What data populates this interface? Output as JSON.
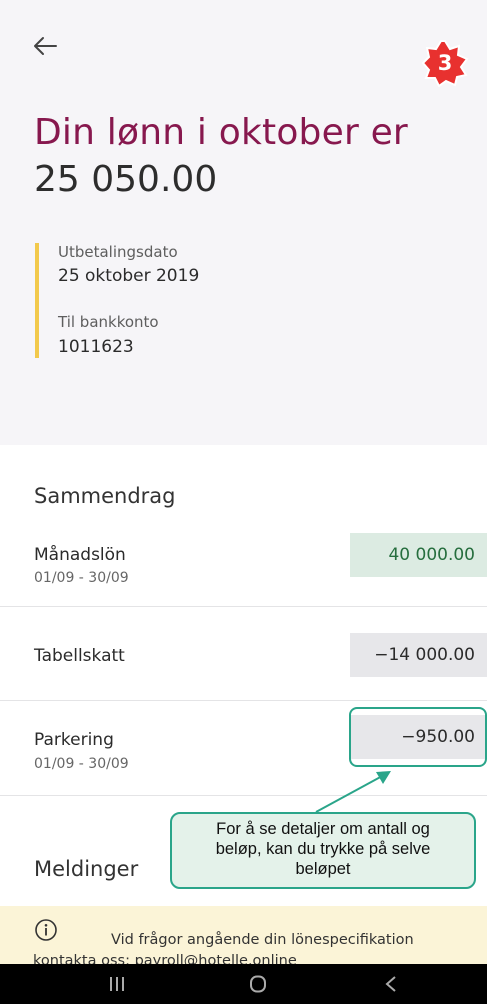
{
  "step_badge": "3",
  "header": {
    "title_line1": "Din lønn i oktober er",
    "title_line2": "25 050.00"
  },
  "payment_info": {
    "date_label": "Utbetalingsdato",
    "date_value": "25 oktober 2019",
    "account_label": "Til bankkonto",
    "account_value": "1011623"
  },
  "summary": {
    "title": "Sammendrag",
    "rows": [
      {
        "label": "Månadslön",
        "period": "01/09 - 30/09",
        "amount": "40 000.00"
      },
      {
        "label": "Tabellskatt",
        "period": "",
        "amount": "−14 000.00"
      },
      {
        "label": "Parkering",
        "period": "01/09 - 30/09",
        "amount": "−950.00"
      }
    ]
  },
  "messages": {
    "title": "Meldinger",
    "notice_line1": "Vid frågor angående din lönespecifikation",
    "notice_line2": "kontakta oss: payroll@hotelle.online"
  },
  "callout": {
    "line1": "For å se detaljer om antall og",
    "line2": "beløp, kan du trykke på selve",
    "line3": "beløpet"
  },
  "colors": {
    "title_accent": "#87184e",
    "info_bar": "#f2c94c",
    "positive_amount_bg": "#dcebe2",
    "negative_amount_bg": "#e7e7ea",
    "annotation": "#2aa58a",
    "badge": "#e8312f",
    "banner_bg": "#fbf4d7"
  },
  "icons": {
    "back": "arrow-left-icon",
    "info": "info-circle-icon",
    "nav_recents": "recents-icon",
    "nav_home": "home-icon",
    "nav_back": "back-chevron-icon"
  }
}
